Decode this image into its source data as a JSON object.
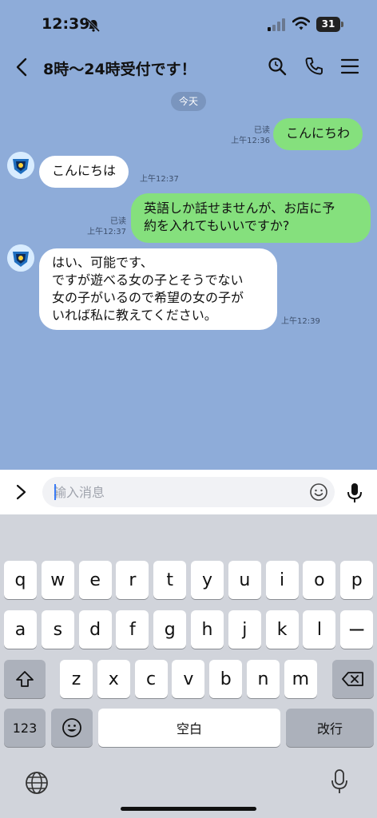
{
  "status_bar": {
    "time": "12:39",
    "battery": "31"
  },
  "header": {
    "title": "8時～24時受付です！"
  },
  "chat": {
    "date_divider": "今天",
    "messages": [
      {
        "side": "out",
        "text": "こんにちわ",
        "read": "已读",
        "time": "上午12:36"
      },
      {
        "side": "in",
        "text": "こんにちは",
        "time": "上午12:37"
      },
      {
        "side": "out",
        "text": "英語しか話せませんが、お店に予\n約を入れてもいいですか?",
        "read": "已读",
        "time": "上午12:37"
      },
      {
        "side": "in",
        "text": "はい、可能です、\nですが遊べる女の子とそうでない\n女の子がいるので希望の女の子が\nいれば私に教えてください。",
        "time": "上午12:39"
      }
    ]
  },
  "input": {
    "placeholder": "输入消息",
    "value": ""
  },
  "keyboard": {
    "row1": [
      "q",
      "w",
      "e",
      "r",
      "t",
      "y",
      "u",
      "i",
      "o",
      "p"
    ],
    "row2": [
      "a",
      "s",
      "d",
      "f",
      "g",
      "h",
      "j",
      "k",
      "l",
      "ー"
    ],
    "row3": [
      "z",
      "x",
      "c",
      "v",
      "b",
      "n",
      "m"
    ],
    "numbers_label": "123",
    "space_label": "空白",
    "return_label": "改行"
  },
  "colors": {
    "background": "#8eacd9",
    "outgoing_bubble": "#85e07d",
    "incoming_bubble": "#ffffff",
    "keyboard": "#d1d4db"
  },
  "icons": [
    "bell-slash-icon",
    "signal-icon",
    "wifi-icon",
    "back-arrow-icon",
    "search-icon",
    "phone-icon",
    "menu-icon",
    "chevron-right-icon",
    "smiley-icon",
    "microphone-icon",
    "shift-icon",
    "backspace-icon",
    "emoji-icon",
    "globe-icon"
  ]
}
